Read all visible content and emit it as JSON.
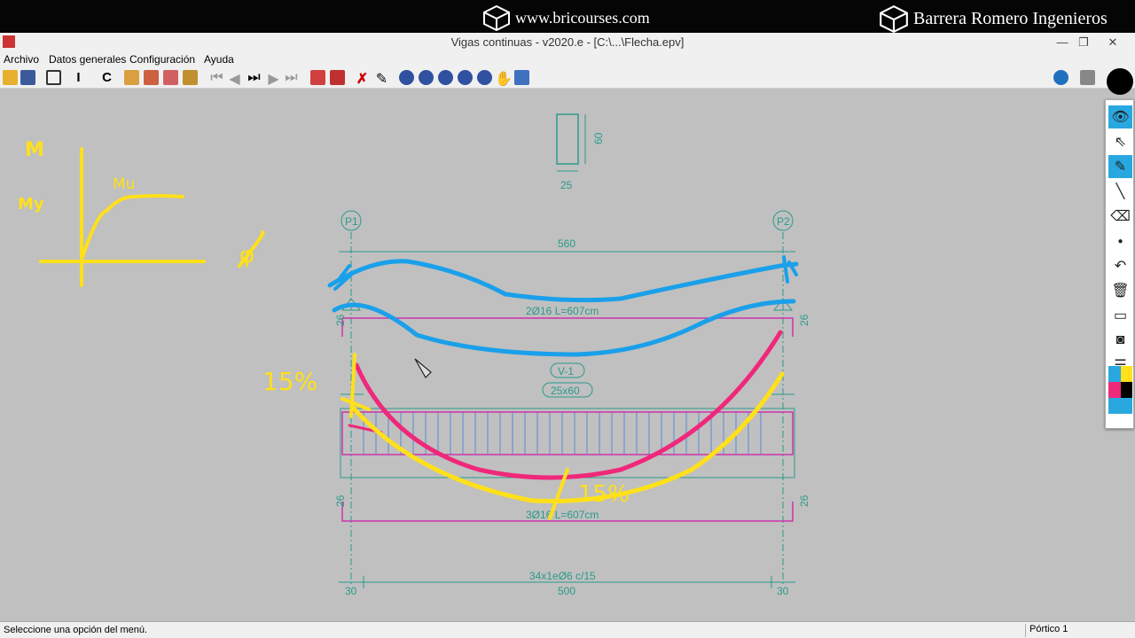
{
  "banner": {
    "site": "www.bricourses.com",
    "brand": "Barrera Romero Ingenieros"
  },
  "window": {
    "title": "Vigas continuas - v2020.e - [C:\\...\\Flecha.epv]",
    "minimize": "—",
    "restore": "❐",
    "close": "✕"
  },
  "menu": {
    "items": [
      "Archivo",
      "Datos generales",
      "Configuración",
      "Ayuda"
    ]
  },
  "status": {
    "message": "Seleccione una opción del menú.",
    "panel": "Pórtico 1"
  },
  "drawing": {
    "section_height": "60",
    "section_width": "25",
    "support_left": "P1",
    "support_right": "P2",
    "span_total": "560",
    "top_rebar": "2Ø16 L=607cm",
    "beam_name": "V-1",
    "beam_size": "25x60",
    "bottom_rebar": "3Ø16 L=607cm",
    "stirrups": "34x1eØ6 c/15",
    "dim_left": "30",
    "dim_mid": "500",
    "dim_right": "30",
    "anchor_top_left": "26",
    "anchor_top_right": "26",
    "anchor_bot_left": "26",
    "anchor_bot_right": "26"
  },
  "annotations": {
    "moment_axis": "M",
    "my_label": "My",
    "mu_label": "Mu",
    "phi": "φ",
    "pct_left": "15%",
    "pct_mid": "15%"
  },
  "colors": {
    "line": "#2a9a8a",
    "rebar": "#cc33aa",
    "blue_ink": "#1aa0ea",
    "pink_ink": "#f0287a",
    "yellow_ink": "#ffe01a",
    "accent_blue": "#29a8e0"
  },
  "side_tools": [
    "eye-icon",
    "pointer-icon",
    "pen-icon",
    "line-icon",
    "eraser-icon",
    "dot-icon",
    "undo-icon",
    "trash-icon",
    "board-icon",
    "camera-icon",
    "clipboard-icon",
    "palette-icon"
  ]
}
